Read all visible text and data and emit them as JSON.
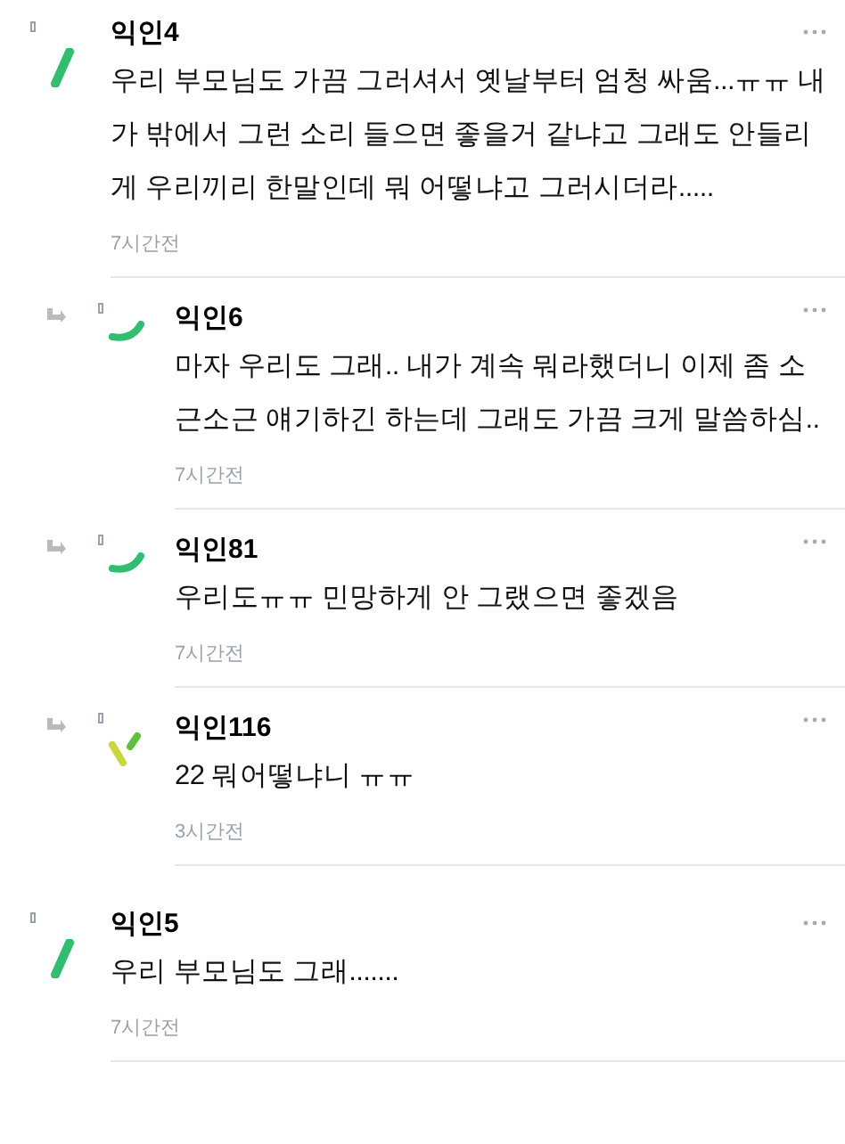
{
  "comments": [
    {
      "author": "익인4",
      "text": "우리 부모님도 가끔 그러셔서 옛날부터 엄청 싸움...ㅠㅠ 내가 밖에서 그런 소리 들으면 좋을거 같냐고 그래도 안들리게 우리끼리 한말인데 뭐 어떻냐고 그러시더라.....",
      "time": "7시간전",
      "children": [
        {
          "author": "익인6",
          "text": "마자 우리도 그래.. 내가 계속 뭐라했더니 이제 좀 소근소근 얘기하긴 하는데 그래도 가끔 크게 말씀하심..",
          "time": "7시간전"
        },
        {
          "author": "익인81",
          "text": "우리도ㅠㅠ 민망하게 안 그랬으면 좋겠음",
          "time": "7시간전"
        },
        {
          "author": "익인116",
          "text": "22 뭐어떻냐니 ㅠㅠ",
          "time": "3시간전"
        }
      ]
    },
    {
      "author": "익인5",
      "text": "우리 부모님도 그래.......",
      "time": "7시간전"
    }
  ]
}
